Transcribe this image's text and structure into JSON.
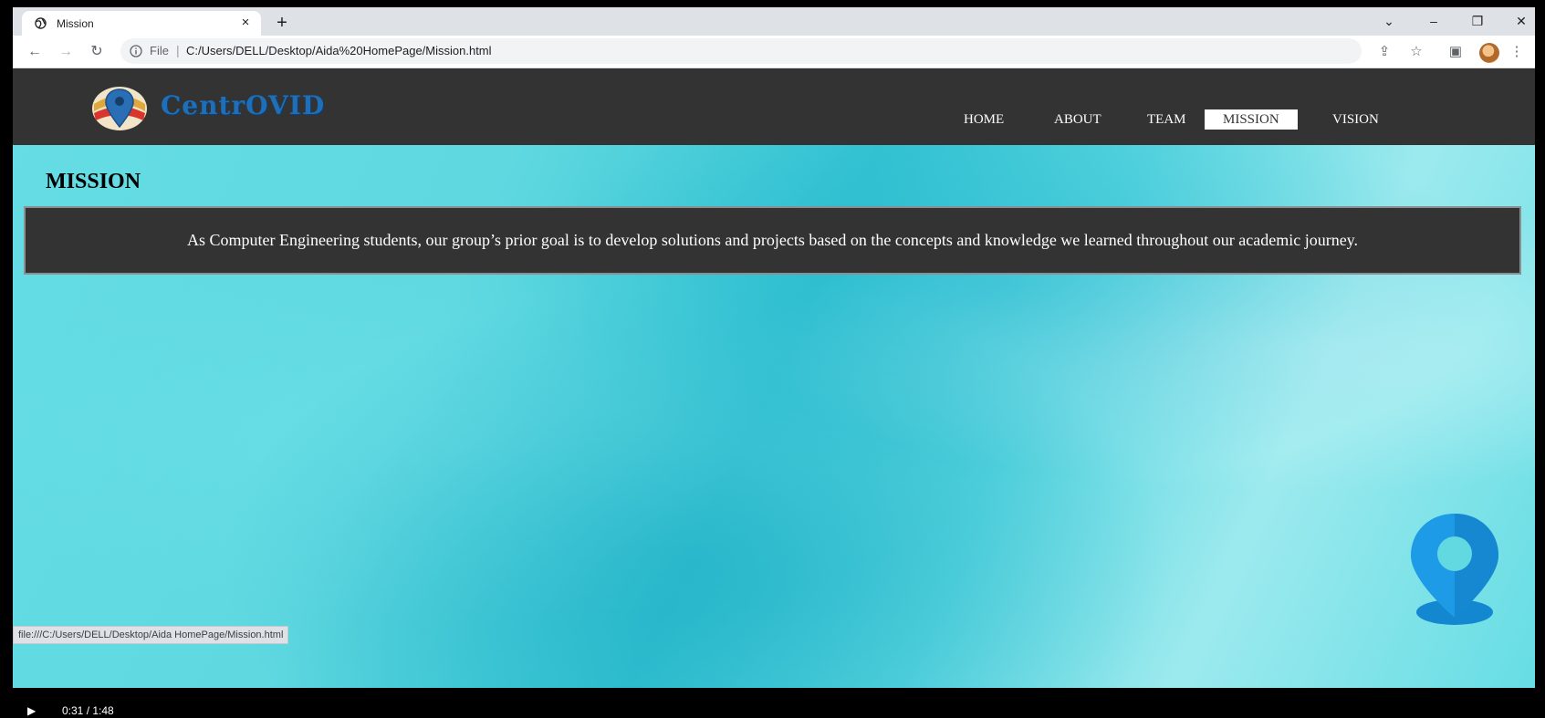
{
  "browser": {
    "tab_title": "Mission",
    "new_tab": "+",
    "close_tab": "×",
    "scheme_label": "File",
    "url": "C:/Users/DELL/Desktop/Aida%20HomePage/Mission.html",
    "status_url": "file:///C:/Users/DELL/Desktop/Aida HomePage/Mission.html"
  },
  "site": {
    "logo_text": "CentrOVID",
    "nav": [
      {
        "label": "HOME"
      },
      {
        "label": "ABOUT"
      },
      {
        "label": "TEAM"
      },
      {
        "label": "MISSION",
        "active": true
      },
      {
        "label": "VISION"
      }
    ]
  },
  "page": {
    "heading": "MISSION",
    "mission_text": "As Computer Engineering students, our group’s prior goal is to develop solutions and projects based on the concepts and knowledge we learned throughout our academic journey."
  },
  "player": {
    "time": "0:31 / 1:48"
  },
  "colors": {
    "header_bg": "#333333",
    "accent": "#1e6fb8",
    "page_bg": "#5fd8e0",
    "pin": "#1e9be6"
  }
}
